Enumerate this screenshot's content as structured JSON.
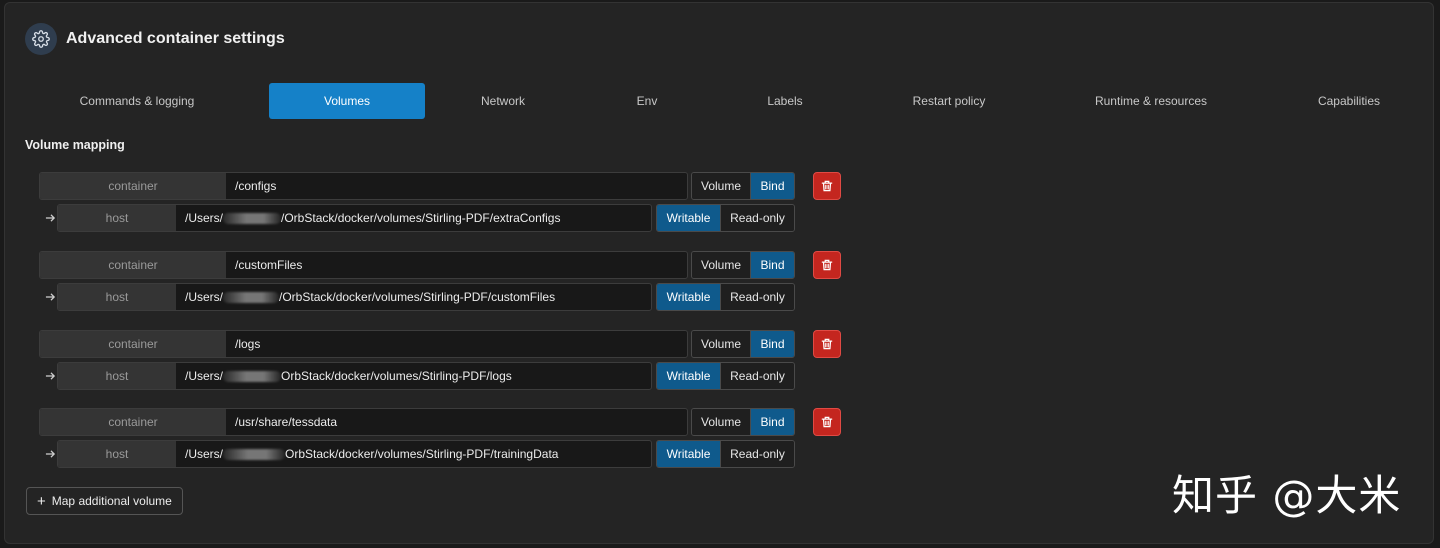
{
  "header": {
    "title": "Advanced container settings",
    "icon": "gear-icon"
  },
  "tabs": [
    {
      "label": "Commands & logging",
      "active": false
    },
    {
      "label": "Volumes",
      "active": true
    },
    {
      "label": "Network",
      "active": false
    },
    {
      "label": "Env",
      "active": false
    },
    {
      "label": "Labels",
      "active": false
    },
    {
      "label": "Restart policy",
      "active": false
    },
    {
      "label": "Runtime & resources",
      "active": false
    },
    {
      "label": "Capabilities",
      "active": false
    }
  ],
  "section": {
    "label": "Volume mapping"
  },
  "labels": {
    "container": "container",
    "host": "host",
    "volume": "Volume",
    "bind": "Bind",
    "writable": "Writable",
    "readonly": "Read-only"
  },
  "mappings": [
    {
      "container_path": "/configs",
      "host_prefix": "/Users/",
      "host_suffix": "/OrbStack/docker/volumes/Stirling-PDF/extraConfigs",
      "type": "Bind",
      "mode": "Writable"
    },
    {
      "container_path": "/customFiles",
      "host_prefix": "/Users/",
      "host_suffix": "/OrbStack/docker/volumes/Stirling-PDF/customFiles",
      "type": "Bind",
      "mode": "Writable"
    },
    {
      "container_path": "/logs",
      "host_prefix": "/Users/",
      "host_suffix": "OrbStack/docker/volumes/Stirling-PDF/logs",
      "type": "Bind",
      "mode": "Writable"
    },
    {
      "container_path": "/usr/share/tessdata",
      "host_prefix": "/Users/",
      "host_suffix": "OrbStack/docker/volumes/Stirling-PDF/trainingData",
      "type": "Bind",
      "mode": "Writable"
    }
  ],
  "add_button": {
    "label": "Map additional volume"
  },
  "watermark": {
    "text": "知乎 @大米"
  },
  "colors": {
    "accent": "#1581c8",
    "toggle_on": "#0f5a8c",
    "danger": "#c4261f"
  }
}
